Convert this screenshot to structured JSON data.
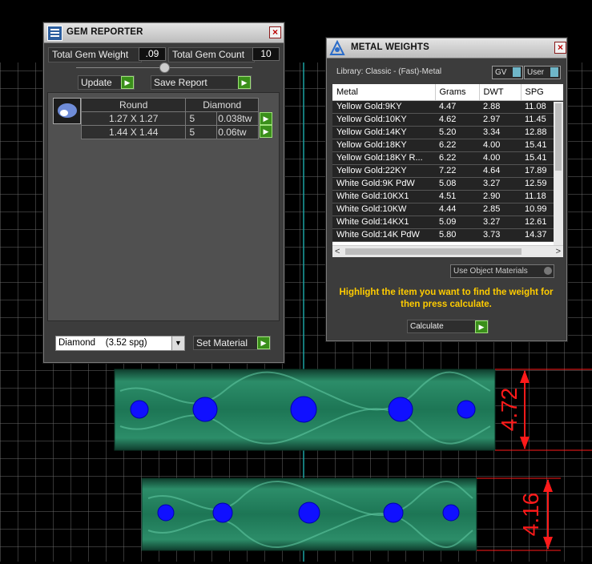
{
  "gem_reporter": {
    "title": "GEM REPORTER",
    "total_gem_weight_label": "Total Gem Weight",
    "total_gem_weight_value": ".09",
    "total_gem_count_label": "Total Gem Count",
    "total_gem_count_value": "10",
    "update_label": "Update",
    "save_report_label": "Save Report",
    "table": {
      "header_shape": "Round",
      "header_material": "Diamond",
      "rows": [
        {
          "size": "1.27 X 1.27",
          "count": "5",
          "weight": "0.038tw"
        },
        {
          "size": "1.44 X 1.44",
          "count": "5",
          "weight": "0.06tw"
        }
      ]
    },
    "material_select": "Diamond    (3.52 spg)",
    "set_material_label": "Set Material"
  },
  "metal_weights": {
    "title": "METAL WEIGHTS",
    "library": "Library: Classic - (Fast)-Metal",
    "gv_label": "GV",
    "user_label": "User",
    "columns": [
      "Metal",
      "Grams",
      "DWT",
      "SPG"
    ],
    "rows": [
      [
        "Yellow Gold:9KY",
        "4.47",
        "2.88",
        "11.08"
      ],
      [
        "Yellow Gold:10KY",
        "4.62",
        "2.97",
        "11.45"
      ],
      [
        "Yellow Gold:14KY",
        "5.20",
        "3.34",
        "12.88"
      ],
      [
        "Yellow Gold:18KY",
        "6.22",
        "4.00",
        "15.41"
      ],
      [
        "Yellow Gold:18KY R...",
        "6.22",
        "4.00",
        "15.41"
      ],
      [
        "Yellow Gold:22KY",
        "7.22",
        "4.64",
        "17.89"
      ],
      [
        "White Gold:9K PdW",
        "5.08",
        "3.27",
        "12.59"
      ],
      [
        "White Gold:10KX1",
        "4.51",
        "2.90",
        "11.18"
      ],
      [
        "White Gold:10KW",
        "4.44",
        "2.85",
        "10.99"
      ],
      [
        "White Gold:14KX1",
        "5.09",
        "3.27",
        "12.61"
      ],
      [
        "White Gold:14K PdW",
        "5.80",
        "3.73",
        "14.37"
      ]
    ],
    "use_object_materials_label": "Use Object Materials",
    "hint": "Highlight the item you want to find the weight for then press calculate.",
    "calculate_label": "Calculate"
  },
  "dimensions": {
    "upper": "4.72",
    "lower": "4.16"
  },
  "colors": {
    "band_green": "#1f7a5c",
    "gem_blue": "#1010ff",
    "dimension_red": "#ff1a1a",
    "hint_yellow": "#ffcc00",
    "button_green": "#3a8f1a"
  }
}
